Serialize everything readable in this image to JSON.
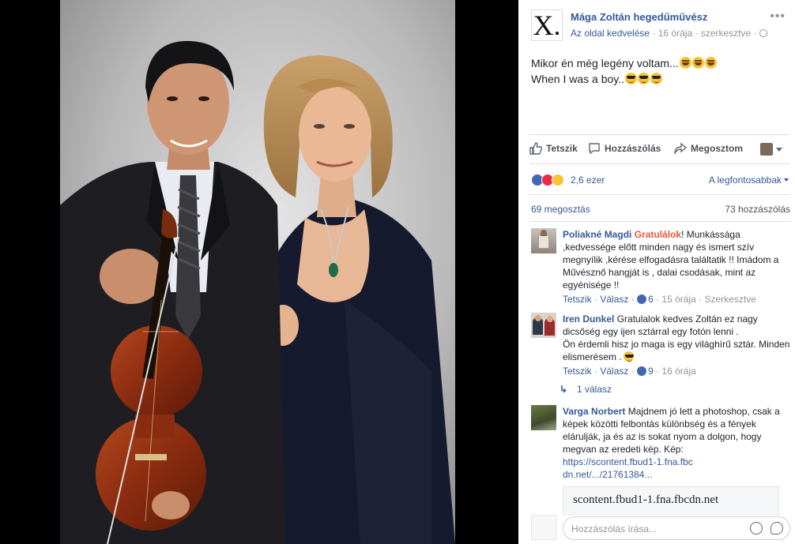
{
  "page": {
    "avatar_letter": "X.",
    "name": "Mága Zoltán hegedűművész",
    "like_page": "Az oldal kedvelése",
    "time": "16 órája",
    "edited": "szerkesztve",
    "dot": "·"
  },
  "post": {
    "line1": "Mikor én még legény voltam...",
    "line2": "When I was a boy..",
    "emoji_line1": "grinning-squinting-face-icon x3",
    "emoji_line2": "smiling-face-with-sunglasses-icon x3"
  },
  "actions": {
    "like": "Tetszik",
    "comment": "Hozzászólás",
    "share": "Megosztom"
  },
  "reactions": {
    "count": "2,6 ezer",
    "sort": "A legfontosabbak"
  },
  "stats": {
    "shares": "69 megosztás",
    "comments": "73 hozzászólás"
  },
  "comments": [
    {
      "author": "Poliakné Magdi",
      "highlight": "Gratulálok",
      "text": "! Munkássága ,kedvessége előtt minden nagy és ismert szív megnyílik ,kérése elfogadásra találtatik !! Imádom a Művésznő hangját is , dalai csodásak, mint az egyénisége !!",
      "like": "Tetszik",
      "reply": "Válasz",
      "likes": "6",
      "time": "15 órája",
      "edited": "Szerkesztve"
    },
    {
      "author": "Iren Dunkel",
      "text": "Gratulalok kedves Zoltán ez nagy dicsőség egy ijen sztárral egy fotón lenni .",
      "text2": "Ön érdemli hisz jo maga is egy világhírű sztár. Minden elismerésem .",
      "like": "Tetszik",
      "reply": "Válasz",
      "likes": "9",
      "time": "16 órája"
    },
    {
      "author": "Varga Norbert",
      "text": "Majdnem jó lett a photoshop, csak a képek közötti felbontás különbség és a fények elárulják, ja és az is sokat nyom a dolgon, hogy megvan az eredeti kép. Kép:",
      "link": "https://scontent.fbud1-1.fna.fbcdn.net/.../21761384..."
    }
  ],
  "replies": "1 válasz",
  "preview_domain": "scontent.fbud1-1.fna.fbcdn.net",
  "composer": {
    "placeholder": "Hozzászólás írása..."
  },
  "colors": {
    "link": "#365899",
    "muted": "#90949c",
    "highlight": "#e9573f",
    "like_blue": "#4267b2",
    "love_red": "#f0284a",
    "wow_yellow": "#f7c533"
  }
}
